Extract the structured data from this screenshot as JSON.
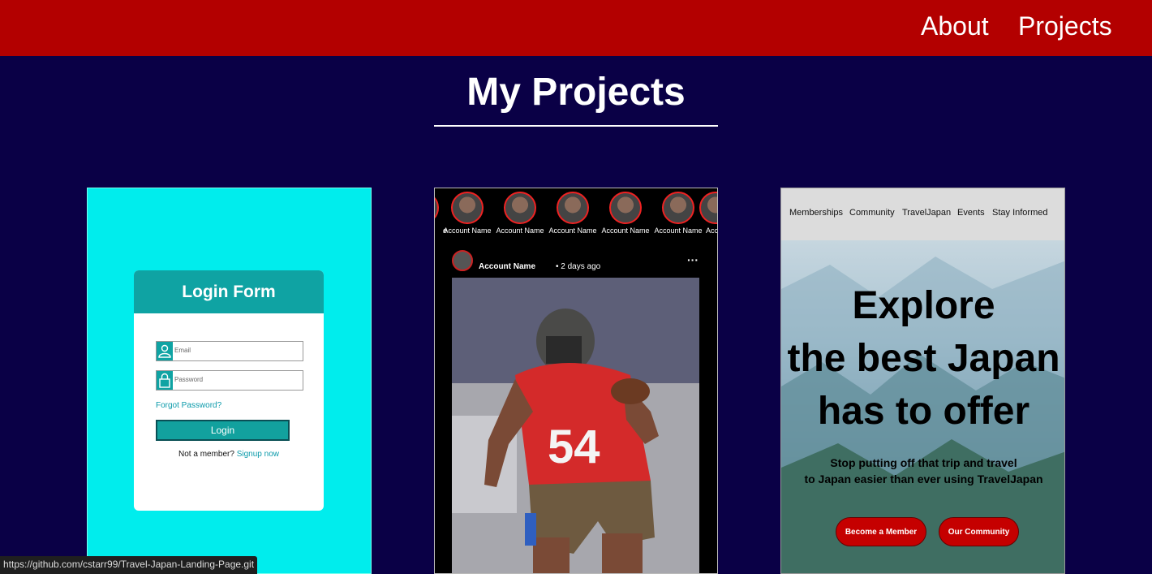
{
  "header": {
    "nav": [
      {
        "label": "About"
      },
      {
        "label": "Projects"
      }
    ],
    "background": "#b30000"
  },
  "page": {
    "title": "My Projects",
    "background": "#0a0046"
  },
  "projects": {
    "login": {
      "form_title": "Login Form",
      "email_placeholder": "Email",
      "password_placeholder": "Password",
      "forgot": "Forgot Password?",
      "login_button": "Login",
      "member_text": "Not a member?",
      "signup": "Signup now",
      "accent": "#0fa3a3"
    },
    "social": {
      "stories": [
        {
          "name": "e"
        },
        {
          "name": "Account Name"
        },
        {
          "name": "Account Name"
        },
        {
          "name": "Account Name"
        },
        {
          "name": "Account Name"
        },
        {
          "name": "Account Name"
        },
        {
          "name": "Acc"
        }
      ],
      "post_user": "Account Name",
      "post_time": "2 days ago",
      "more_icon": "ellipsis-icon",
      "jersey_number": "54"
    },
    "travel": {
      "nav": [
        "Memberships",
        "Community",
        "TravelJapan",
        "Events",
        "Stay Informed"
      ],
      "headline_lines": [
        "Explore",
        "the best Japan",
        "has to offer"
      ],
      "sub_lines": [
        "Stop putting off that trip and travel",
        "to Japan easier than ever using TravelJapan"
      ],
      "button_member": "Become a Member",
      "button_community": "Our Community",
      "button_color": "#c50000"
    }
  },
  "status_bar": {
    "url": "https://github.com/cstarr99/Travel-Japan-Landing-Page.git"
  }
}
